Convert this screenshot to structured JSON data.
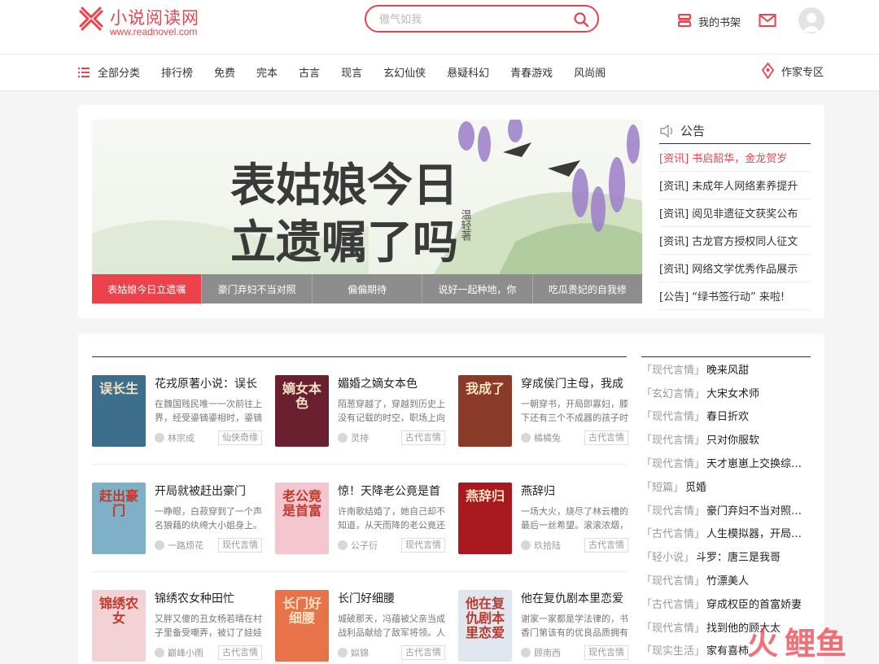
{
  "header": {
    "logo_title": "小说阅读网",
    "logo_url": "www.readnovel.com",
    "search_placeholder": "傲气如我",
    "shelf_label": "我的书架",
    "brand_color": "#ed424b"
  },
  "nav": {
    "all_categories": "全部分类",
    "items": [
      "排行榜",
      "免费",
      "完本",
      "古言",
      "现言",
      "玄幻仙侠",
      "悬疑科幻",
      "青春游戏",
      "风尚阁"
    ],
    "author_zone": "作家专区"
  },
  "banner": {
    "title_line1": "表姑娘今日",
    "title_line2": "立遗嘱了吗",
    "author_side": "温轻著",
    "tabs": [
      "表姑娘今日立遗嘱",
      "豪门弃妇不当对照",
      "偏偏期待",
      "说好一起种地，你",
      "吃瓜贵妃的自我修"
    ],
    "active_tab": 0
  },
  "notice": {
    "title": "公告",
    "items": [
      {
        "text": "[资讯] 书启韶华，金龙贺岁",
        "hot": true
      },
      {
        "text": "[资讯] 未成年人网络素养提升",
        "hot": false
      },
      {
        "text": "[资讯] 阅见非遗征文获奖公布",
        "hot": false
      },
      {
        "text": "[资讯] 古龙官方授权同人征文",
        "hot": false
      },
      {
        "text": "[资讯] 网络文学优秀作品展示",
        "hot": false
      },
      {
        "text": "[公告] “绿书签行动” 来啦!",
        "hot": false
      }
    ]
  },
  "books": [
    {
      "title": "花戎原著小说：误长",
      "desc": "在魏国贱民唯一一次前往上界，经受鎏镝鎏相时，鎏镝",
      "author": "林宗成",
      "genre": "仙侠奇缘",
      "cover_text": "误长生",
      "cover_bg": "#3d6e8c"
    },
    {
      "title": "媚婚之嫡女本色",
      "desc": "陌葱穿越了，穿越到历史上没有记载的时空，职场上向",
      "author": "灵排",
      "genre": "古代言情",
      "cover_text": "嫡女本色",
      "cover_bg": "#6b2030"
    },
    {
      "title": "穿成侯门主母，我成",
      "desc": "一朝穿书，开局即寡妇，膝下还有三个不成器的孩子时",
      "author": "橘橘兔",
      "genre": "古代言情",
      "cover_text": "我成了",
      "cover_bg": "#8c3a28"
    },
    {
      "title": "开局就被赶出豪门",
      "desc": "一睁眼，白菽穿到了一个声名狼藉的纨绔大小姐身上。",
      "author": "一路烦花",
      "genre": "现代言情",
      "cover_text": "赶出豪门",
      "cover_bg": "#7eb0c8"
    },
    {
      "title": "惊！天降老公竟是首",
      "desc": "许南歌结婚了，她自己却不知道，从天而降的老公竟还",
      "author": "公子衍",
      "genre": "现代言情",
      "cover_text": "老公竟是首富",
      "cover_bg": "#f4c6cf"
    },
    {
      "title": "燕辞归",
      "desc": "一场大火，烧尽了林云槽的最后一丝希望。滚滚浓烟，",
      "author": "玖拾陆",
      "genre": "古代言情",
      "cover_text": "燕辞归",
      "cover_bg": "#a8181e"
    },
    {
      "title": "锦绣农女种田忙",
      "desc": "又胖又傻的丑女杨若晴在村子里备受嘲弄，被订了娃娃",
      "author": "巅峰小雨",
      "genre": "古代言情",
      "cover_text": "锦绣农女",
      "cover_bg": "#f2d2d4"
    },
    {
      "title": "长门好细腰",
      "desc": "城破那天，冯蕴被父亲当成战利品献给了敌军将领。人",
      "author": "姒锦",
      "genre": "古代言情",
      "cover_text": "长门好细腰",
      "cover_bg": "#e8734a"
    },
    {
      "title": "他在复仇剧本里恋爱",
      "desc": "谢家一家都是学法律的，书香门第该有的优良品质拥有",
      "author": "顾南西",
      "genre": "现代言情",
      "cover_text": "他在复仇剧本里恋爱",
      "cover_bg": "#dfe6ee"
    }
  ],
  "rank": [
    {
      "cat": "「现代言情」",
      "name": "晚来风甜"
    },
    {
      "cat": "「玄幻言情」",
      "name": "大宋女术师"
    },
    {
      "cat": "「现代言情」",
      "name": "春日折欢"
    },
    {
      "cat": "「现代言情」",
      "name": "只对你服软"
    },
    {
      "cat": "「现代言情」",
      "name": "天才崽崽上交换综艺考…"
    },
    {
      "cat": "「短篇」",
      "name": "觅婚"
    },
    {
      "cat": "「现代言情」",
      "name": "豪门弃妇不当对照组后…"
    },
    {
      "cat": "「古代言情」",
      "name": "人生模拟器，开局一宫女"
    },
    {
      "cat": "「轻小说」",
      "name": "斗罗：唐三是我哥"
    },
    {
      "cat": "「现代言情」",
      "name": "竹漂美人"
    },
    {
      "cat": "「古代言情」",
      "name": "穿成权臣的首富娇妻"
    },
    {
      "cat": "「现代言情」",
      "name": "找到他的顾大太"
    },
    {
      "cat": "「现实生活」",
      "name": "家有喜柿"
    }
  ],
  "watermark": {
    "text": "鲤鱼"
  }
}
